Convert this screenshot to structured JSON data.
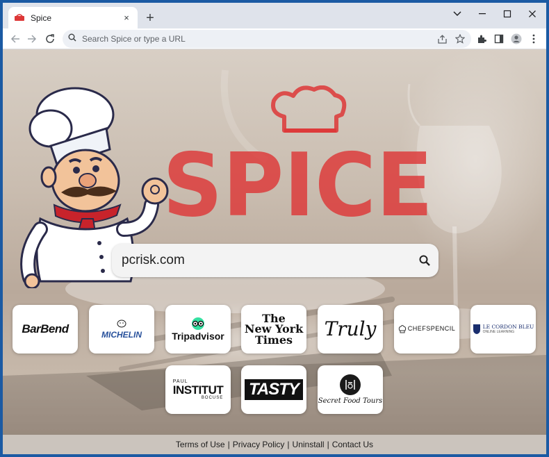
{
  "browser": {
    "tab_title": "Spice",
    "tab_close": "×",
    "new_tab": "+",
    "omnibox_placeholder": "Search Spice or type a URL"
  },
  "logo": {
    "text": "SPICE"
  },
  "search": {
    "value": "pcrisk.com"
  },
  "tiles": [
    {
      "name": "BarBend",
      "text": "BarBend"
    },
    {
      "name": "Michelin",
      "text": "MICHELIN"
    },
    {
      "name": "Tripadvisor",
      "text": "Tripadvisor"
    },
    {
      "name": "The New York Times",
      "line1": "The",
      "line2": "New York",
      "line3": "Times"
    },
    {
      "name": "Truly",
      "text": "Truly"
    },
    {
      "name": "Chefs Pencil",
      "text": "CHEFSPENCIL"
    },
    {
      "name": "Le Cordon Bleu",
      "line1": "LE CORDON BLEU",
      "line2": "ONLINE LEARNING"
    },
    {
      "name": "Paul Institut Bocuse",
      "line1": "PAUL",
      "line2": "INSTITUT",
      "line3": "BOCUSE"
    },
    {
      "name": "Tasty",
      "text": "TASTY"
    },
    {
      "name": "Secret Food Tours",
      "text": "Secret Food Tours"
    }
  ],
  "footer": {
    "links": [
      "Terms of Use",
      "Privacy Policy",
      "Uninstall",
      "Contact Us"
    ],
    "separator": "|"
  },
  "colors": {
    "brand_red": "#dd3737",
    "window_frame": "#1b5aa3",
    "tab_strip": "#dfe3eb"
  },
  "icons": [
    "spice-favicon-icon",
    "back-icon",
    "forward-icon",
    "reload-icon",
    "search-icon",
    "share-icon",
    "star-icon",
    "extensions-icon",
    "side-panel-icon",
    "profile-icon",
    "menu-icon",
    "minimize-icon",
    "maximize-icon",
    "close-icon",
    "chevron-down-icon"
  ]
}
